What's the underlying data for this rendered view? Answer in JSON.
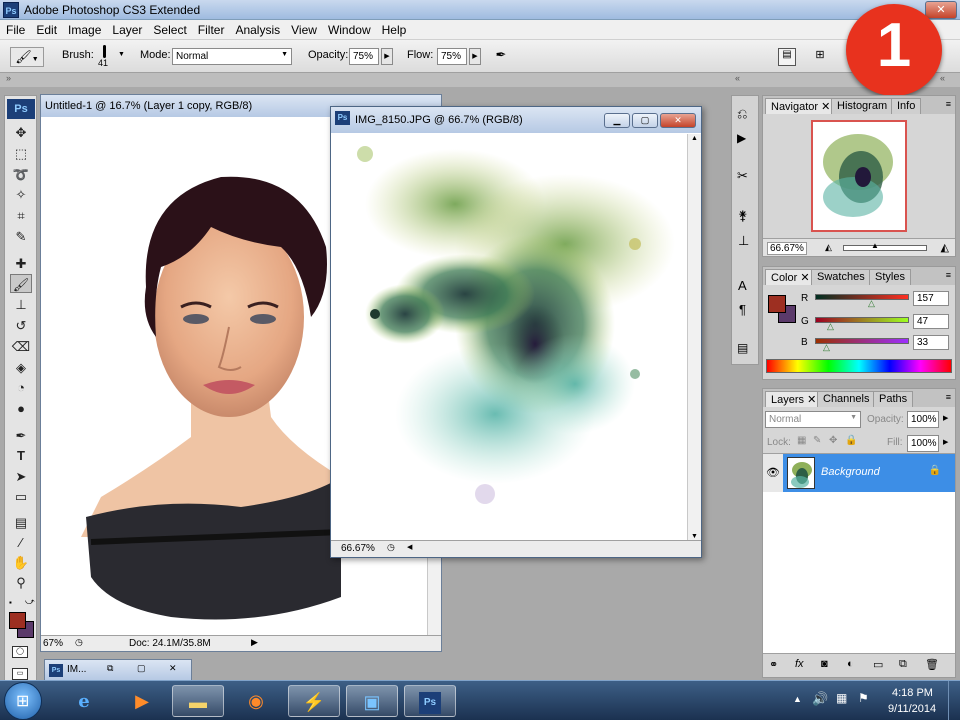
{
  "app": {
    "title": "Adobe Photoshop CS3 Extended",
    "logo": "Ps"
  },
  "menu": [
    "File",
    "Edit",
    "Image",
    "Layer",
    "Select",
    "Filter",
    "Analysis",
    "View",
    "Window",
    "Help"
  ],
  "options": {
    "brush_label": "Brush:",
    "brush_size": "41",
    "mode_label": "Mode:",
    "mode_value": "Normal",
    "opacity_label": "Opacity:",
    "opacity_value": "75%",
    "flow_label": "Flow:",
    "flow_value": "75%"
  },
  "badge": {
    "number": "1",
    "color": "#e8321e"
  },
  "doc1": {
    "title": "Untitled-1 @ 16.7% (Layer 1 copy, RGB/8)",
    "zoom": "67%",
    "doc_info": "Doc: 24.1M/35.8M"
  },
  "doc2": {
    "title": "IMG_8150.JPG @ 66.7% (RGB/8)",
    "zoom": "66.67%"
  },
  "minimized_doc": {
    "label": "IM..."
  },
  "navigator": {
    "tabs": [
      "Navigator",
      "Histogram",
      "Info"
    ],
    "zoom": "66.67%"
  },
  "color_panel": {
    "tabs": [
      "Color",
      "Swatches",
      "Styles"
    ],
    "channels": [
      {
        "label": "R",
        "value": "157"
      },
      {
        "label": "G",
        "value": "47"
      },
      {
        "label": "B",
        "value": "33"
      }
    ],
    "foreground": "#9d2f21",
    "background": "#5b3a6a"
  },
  "layers_panel": {
    "tabs": [
      "Layers",
      "Channels",
      "Paths"
    ],
    "blend_mode": "Normal",
    "opacity_label": "Opacity:",
    "opacity_value": "100%",
    "lock_label": "Lock:",
    "fill_label": "Fill:",
    "fill_value": "100%",
    "layers": [
      {
        "name": "Background"
      }
    ]
  },
  "taskbar": {
    "time": "4:18 PM",
    "date": "9/11/2014"
  }
}
